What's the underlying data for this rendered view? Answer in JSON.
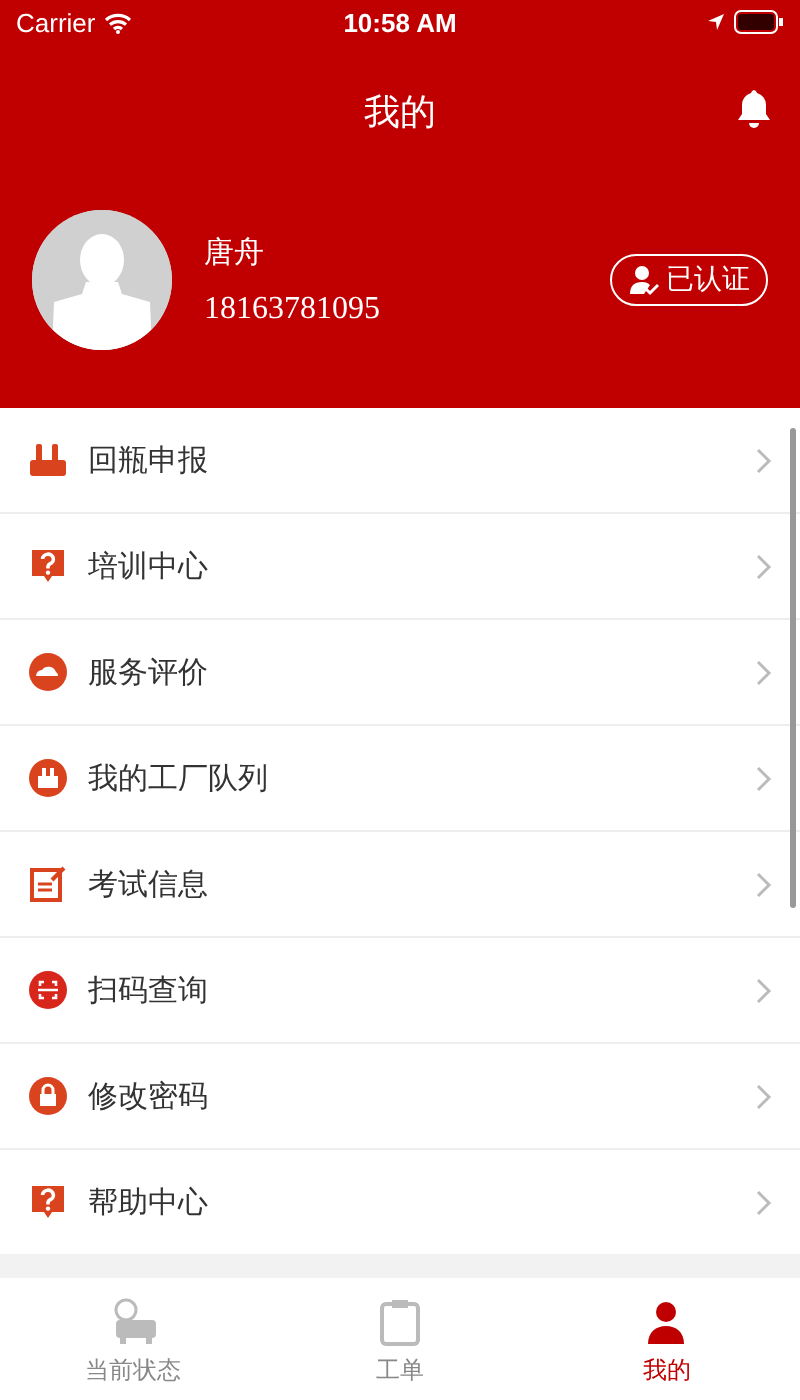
{
  "status_bar": {
    "carrier": "Carrier",
    "time": "10:58 AM"
  },
  "nav": {
    "title": "我的"
  },
  "profile": {
    "name": "唐舟",
    "phone": "18163781095",
    "badge": "已认证"
  },
  "menu": [
    {
      "kind": "bottles",
      "label": "回瓶申报"
    },
    {
      "kind": "question",
      "label": "培训中心"
    },
    {
      "kind": "rating",
      "label": "服务评价"
    },
    {
      "kind": "factory",
      "label": "我的工厂队列"
    },
    {
      "kind": "exam",
      "label": "考试信息"
    },
    {
      "kind": "scan",
      "label": "扫码查询"
    },
    {
      "kind": "lock",
      "label": "修改密码"
    },
    {
      "kind": "question",
      "label": "帮助中心"
    }
  ],
  "tabs": [
    {
      "kind": "status",
      "label": "当前状态",
      "selected": false
    },
    {
      "kind": "orders",
      "label": "工单",
      "selected": false
    },
    {
      "kind": "me",
      "label": "我的",
      "selected": true
    }
  ]
}
